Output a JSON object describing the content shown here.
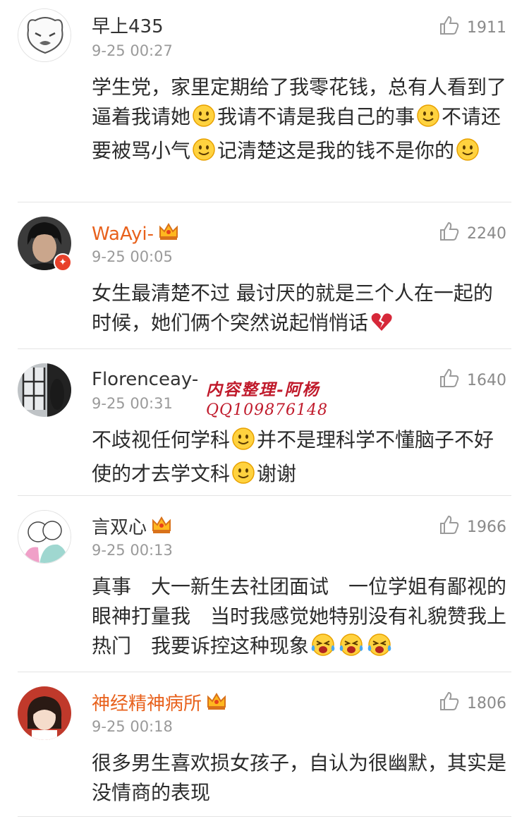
{
  "comments": [
    {
      "username": "早上435",
      "timestamp": "9-25 00:27",
      "likes": "1911",
      "segments": [
        "学生党，家里定期给了我零花钱，总有人看到了逼着我请她",
        "我请不请是我自己的事",
        "不请还要被骂小气",
        "记清楚这是我的钱不是你的"
      ]
    },
    {
      "username": "WaAyi-",
      "timestamp": "9-25 00:05",
      "likes": "2240",
      "segments": [
        "女生最清楚不过 最讨厌的就是三个人在一起的时候，她们俩个突然说起悄悄话"
      ]
    },
    {
      "username": "Florenceay-",
      "timestamp": "9-25 00:31",
      "likes": "1640",
      "segments": [
        "不歧视任何学科",
        "并不是理科学不懂脑子不好使的才去学文科",
        "谢谢"
      ]
    },
    {
      "username": "言双心",
      "timestamp": "9-25 00:13",
      "likes": "1966",
      "segments": [
        "真事　大一新生去社团面试　一位学姐有鄙视的眼神打量我　当时我感觉她特别没有礼貌赞我上热门　我要诉控这种现象"
      ]
    },
    {
      "username": "神经精神病所",
      "timestamp": "9-25 00:18",
      "likes": "1806",
      "segments": [
        "很多男生喜欢损女孩子，自认为很幽默，其实是没情商的表现"
      ]
    }
  ],
  "watermark": {
    "line1": "内容整理-阿杨",
    "line2": "QQ109876148"
  },
  "icons": {
    "like": "thumbs-up-icon",
    "crown": "vip-crown-icon",
    "smile": "smile-emoji-icon",
    "broken_heart": "broken-heart-emoji-icon",
    "crying": "crying-emoji-icon"
  },
  "colors": {
    "vip_name": "#e8611c",
    "text": "#2b2b2b",
    "meta": "#9a9a9a",
    "watermark": "#c01a2b"
  }
}
